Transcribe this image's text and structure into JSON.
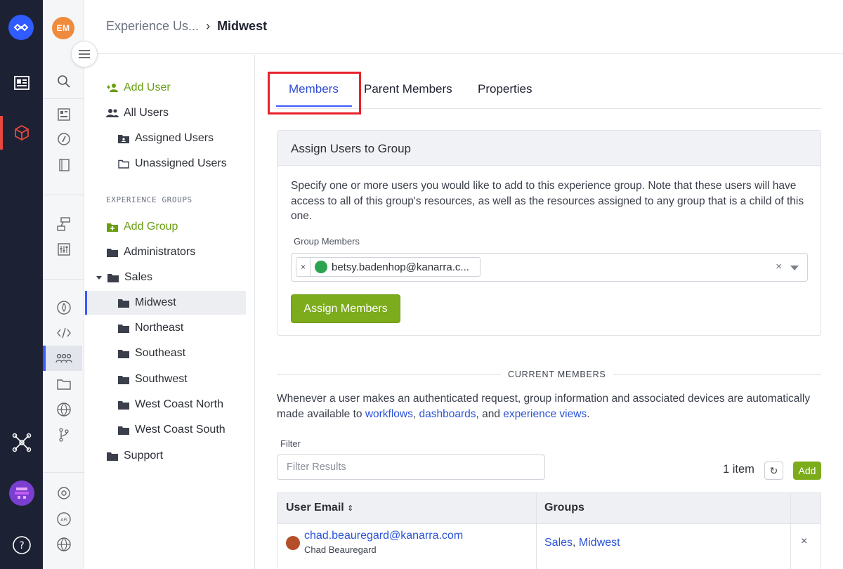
{
  "header": {
    "breadcrumb_parent": "Experience Us...",
    "breadcrumb_sep": "›",
    "breadcrumb_current": "Midwest"
  },
  "user_avatar_initials": "EM",
  "tree": {
    "add_user": "Add User",
    "all_users": "All Users",
    "assigned_users": "Assigned Users",
    "unassigned_users": "Unassigned Users",
    "section_label": "EXPERIENCE GROUPS",
    "add_group": "Add Group",
    "groups": [
      {
        "label": "Administrators"
      },
      {
        "label": "Sales"
      },
      {
        "label": "Midwest"
      },
      {
        "label": "Northeast"
      },
      {
        "label": "Southeast"
      },
      {
        "label": "Southwest"
      },
      {
        "label": "West Coast North"
      },
      {
        "label": "West Coast South"
      },
      {
        "label": "Support"
      }
    ]
  },
  "tabs": [
    {
      "label": "Members"
    },
    {
      "label": "Parent Members"
    },
    {
      "label": "Properties"
    }
  ],
  "assign_card": {
    "title": "Assign Users to Group",
    "description": "Specify one or more users you would like to add to this experience group. Note that these users will have access to all of this group's resources, as well as the resources assigned to any group that is a child of this one.",
    "field_label": "Group Members",
    "chip_remove": "×",
    "chip_value": "betsy.badenhop@kanarra.c...",
    "clear_label": "×",
    "button_label": "Assign Members"
  },
  "members": {
    "divider_label": "CURRENT MEMBERS",
    "desc_prefix": "Whenever a user makes an authenticated request, group information and associated devices are automatically made available to ",
    "link_workflows": "workflows",
    "desc_comma": ", ",
    "link_dashboards": "dashboards",
    "desc_and": ", and ",
    "link_views": "experience views",
    "desc_end": ".",
    "filter_label": "Filter",
    "filter_placeholder": "Filter Results",
    "count": "1 item",
    "refresh_icon": "↻",
    "add_label": "Add",
    "col_email": "User Email",
    "col_sort_icon": "⌃⌄",
    "col_groups": "Groups",
    "rows": [
      {
        "email": "chad.beauregard@kanarra.com",
        "name": "Chad Beauregard",
        "group1": "Sales",
        "group_sep": ", ",
        "group2": "Midwest",
        "remove": "×"
      }
    ]
  },
  "colors": {
    "accent": "#3d5afe",
    "green": "#7cac1b",
    "rail": "#1c2233",
    "highlight": "#e8222a"
  }
}
